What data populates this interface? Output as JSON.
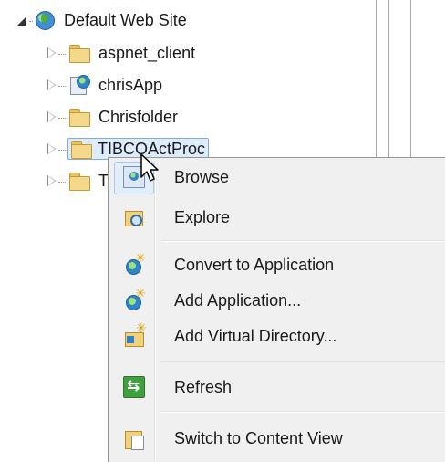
{
  "tree": {
    "root": {
      "label": "Default Web Site",
      "icon": "globe-icon",
      "expanded": true
    },
    "children": [
      {
        "label": "aspnet_client",
        "icon": "folder-icon"
      },
      {
        "label": "chrisApp",
        "icon": "application-icon"
      },
      {
        "label": "Chrisfolder",
        "icon": "folder-icon"
      },
      {
        "label": "TIBCOActProc",
        "icon": "folder-icon",
        "selected": true
      },
      {
        "label": "T",
        "icon": "folder-icon"
      }
    ]
  },
  "context_menu": {
    "items": [
      {
        "label": "Browse",
        "icon": "browse-icon"
      },
      {
        "label": "Explore",
        "icon": "explore-icon"
      },
      {
        "label": "Convert to Application",
        "icon": "convert-application-icon"
      },
      {
        "label": "Add Application...",
        "icon": "add-application-icon"
      },
      {
        "label": "Add Virtual Directory...",
        "icon": "add-virtual-directory-icon"
      },
      {
        "label": "Refresh",
        "icon": "refresh-icon"
      },
      {
        "label": "Switch to Content View",
        "icon": "content-view-icon"
      }
    ]
  },
  "colors": {
    "selection_bg": "#dcecfc",
    "selection_border": "#84acdd",
    "menu_bg": "#f0f0f0"
  }
}
